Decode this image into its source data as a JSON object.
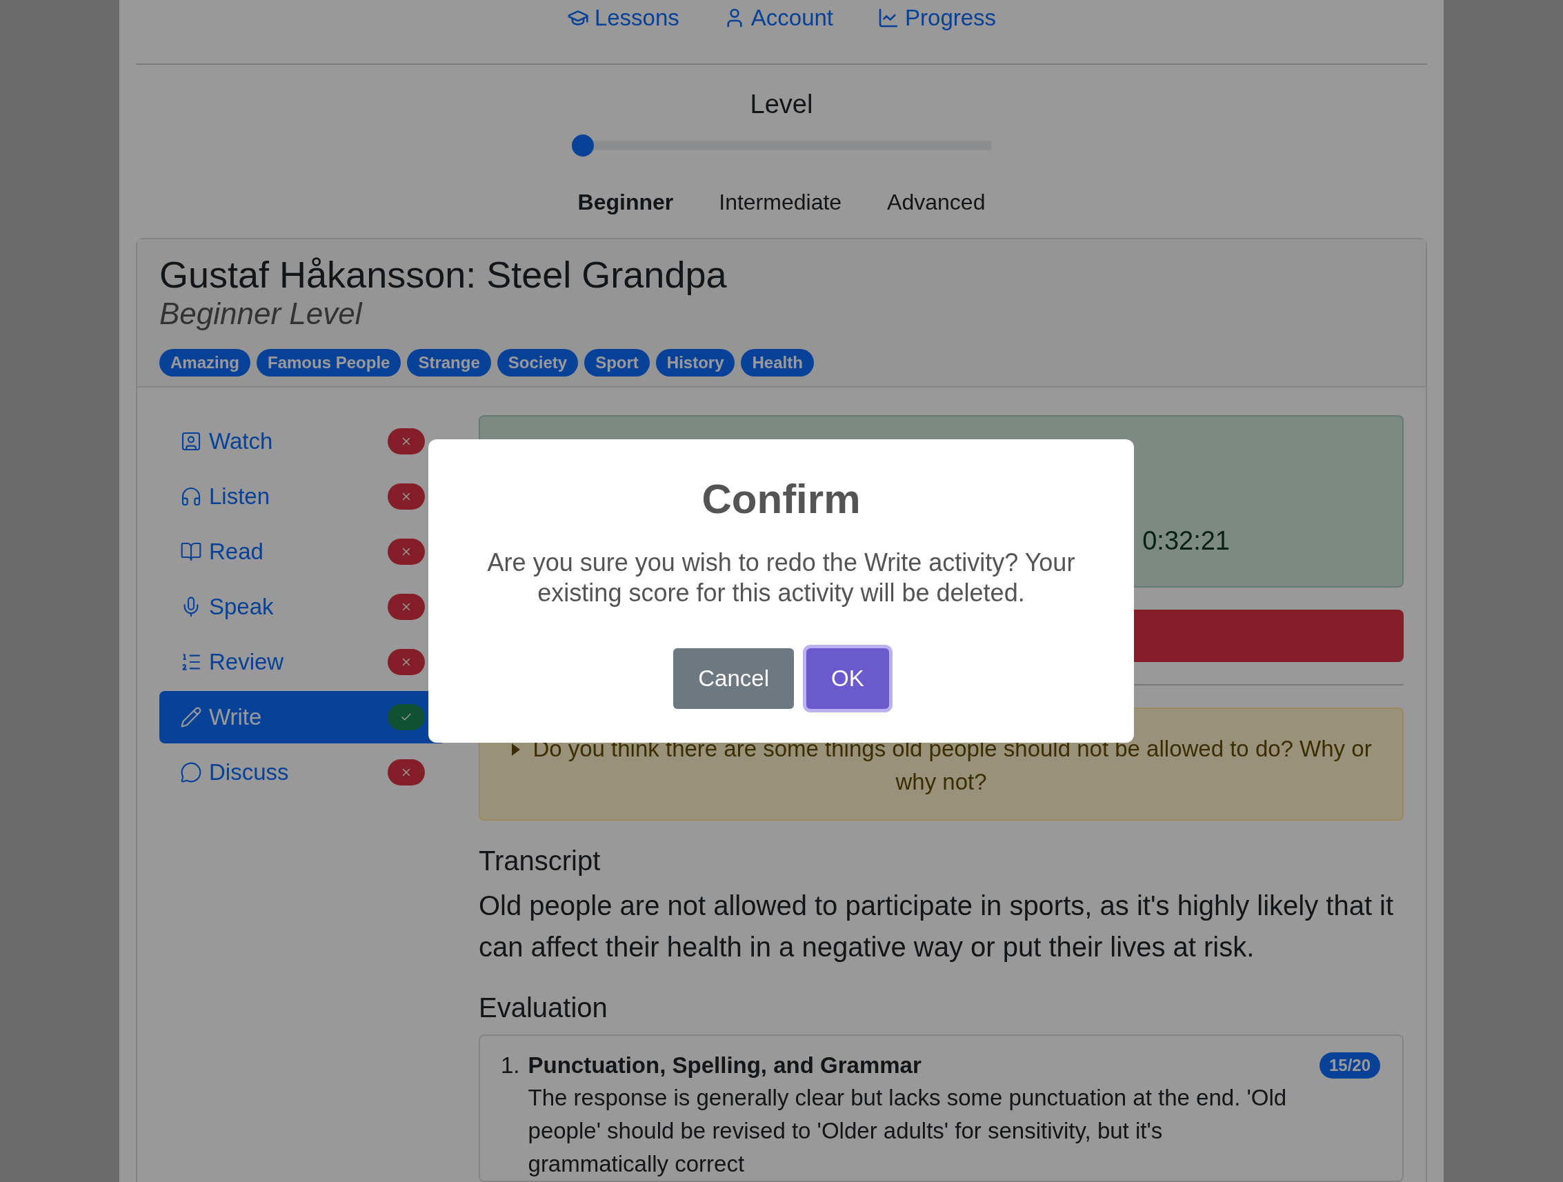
{
  "nav": [
    {
      "label": "Lessons",
      "kind": "lessons"
    },
    {
      "label": "Account",
      "kind": "account"
    },
    {
      "label": "Progress",
      "kind": "progress"
    }
  ],
  "level_picker": {
    "title": "Level",
    "level": 0,
    "options": [
      {
        "label": "Beginner",
        "selected": true
      },
      {
        "label": "Intermediate",
        "selected": false
      },
      {
        "label": "Advanced",
        "selected": false
      }
    ]
  },
  "lesson": {
    "title": "Gustaf Håkansson: Steel Grandpa",
    "subtitle": "Beginner Level",
    "tags": [
      "Amazing",
      "Famous People",
      "Strange",
      "Society",
      "Sport",
      "History",
      "Health"
    ]
  },
  "activities": [
    {
      "label": "Watch",
      "kind": "watch",
      "selected": false,
      "done": false
    },
    {
      "label": "Listen",
      "kind": "listen",
      "selected": false,
      "done": false
    },
    {
      "label": "Read",
      "kind": "read",
      "selected": false,
      "done": false
    },
    {
      "label": "Speak",
      "kind": "speak",
      "selected": false,
      "done": false
    },
    {
      "label": "Review",
      "kind": "review",
      "selected": false,
      "done": false
    },
    {
      "label": "Write",
      "kind": "write",
      "selected": true,
      "done": true
    },
    {
      "label": "Discuss",
      "kind": "discuss",
      "selected": false,
      "done": false
    }
  ],
  "timer": {
    "text": "0:32:21"
  },
  "question": "Do you think there are some things old people should not be allowed to do? Why or why not?",
  "transcript": {
    "heading": "Transcript",
    "text": "Old people are not allowed to participate in sports, as it's highly likely that it can affect their health in a negative way or put their lives at risk."
  },
  "evaluation": {
    "heading": "Evaluation",
    "items": [
      {
        "number": "1.",
        "title": "Punctuation, Spelling, and Grammar",
        "score": "15/20",
        "text": "The response is generally clear but lacks some punctuation at the end. 'Old people' should be revised to 'Older adults' for sensitivity, but it's grammatically correct"
      }
    ]
  },
  "dialog": {
    "title": "Confirm",
    "message": "Are you sure you wish to redo the Write activity? Your existing score for this activity will be deleted.",
    "buttons": [
      {
        "label": "Cancel",
        "kind": "secondary"
      },
      {
        "label": "OK",
        "kind": "primary"
      }
    ]
  }
}
